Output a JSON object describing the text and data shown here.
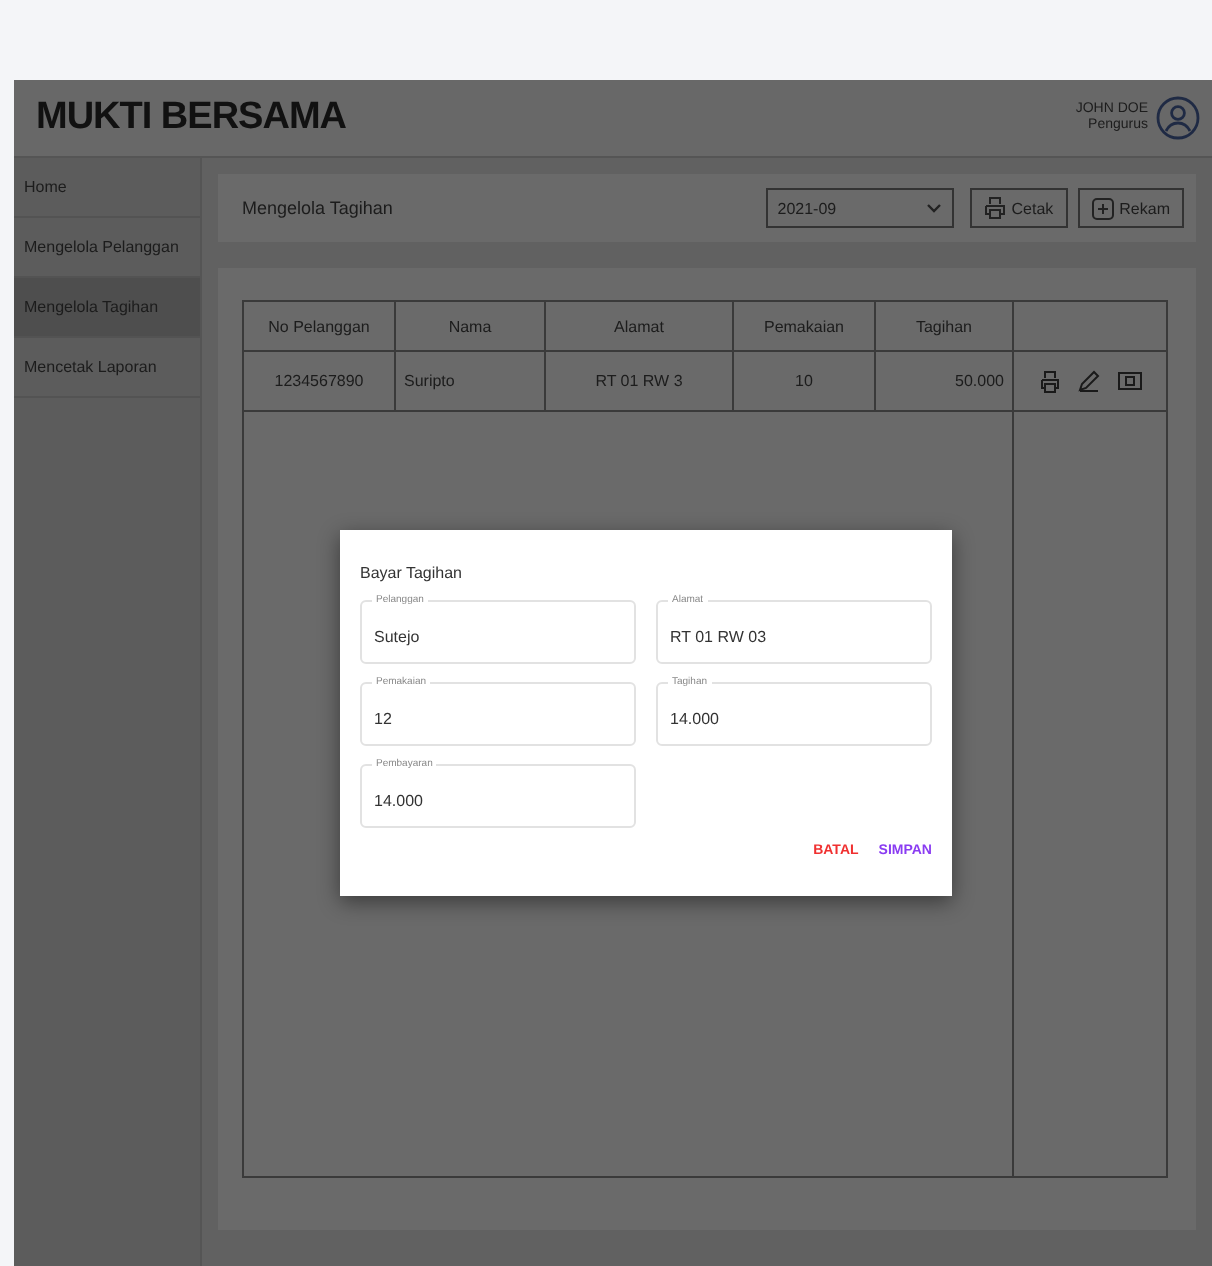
{
  "header": {
    "title": "MUKTI BERSAMA",
    "user_name": "JOHN DOE",
    "user_role": "Pengurus"
  },
  "sidebar": {
    "items": [
      {
        "label": "Home",
        "selected": false
      },
      {
        "label": "Mengelola Pelanggan",
        "selected": false
      },
      {
        "label": "Mengelola Tagihan",
        "selected": true
      },
      {
        "label": "Mencetak Laporan",
        "selected": false
      }
    ]
  },
  "toolbar": {
    "title": "Mengelola Tagihan",
    "period": "2021-09",
    "buttons": [
      {
        "label": "Cetak",
        "kind": "print"
      },
      {
        "label": "Rekam",
        "kind": "add"
      }
    ]
  },
  "table": {
    "columns": [
      "No Pelanggan",
      "Nama",
      "Alamat",
      "Pemakaian",
      "Tagihan"
    ],
    "rows": [
      {
        "cells": [
          "1234567890",
          "Suripto",
          "RT 01 RW 3",
          "10",
          "50.000"
        ]
      }
    ]
  },
  "dialog": {
    "title": "Bayar Tagihan",
    "fields": [
      {
        "label": "Pelanggan",
        "value": "Sutejo"
      },
      {
        "label": "Alamat",
        "value": "RT 01 RW 03"
      },
      {
        "label": "Pemakaian",
        "value": "12"
      },
      {
        "label": "Tagihan",
        "value": "14.000"
      },
      {
        "label": "Pembayaran",
        "value": "14.000"
      }
    ],
    "actions": [
      {
        "label": "BATAL",
        "kind": "cancel"
      },
      {
        "label": "SIMPAN",
        "kind": "confirm"
      }
    ]
  }
}
